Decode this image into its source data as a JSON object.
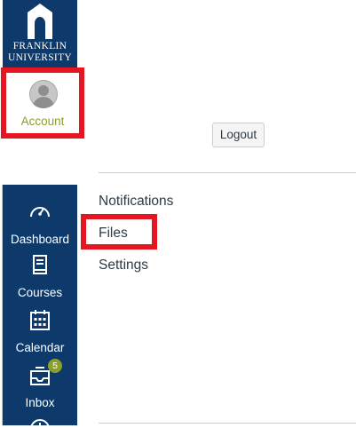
{
  "logo": {
    "line1": "FRANKLIN",
    "line2": "UNIVERSITY"
  },
  "account": {
    "label": "Account"
  },
  "profile": {
    "logout_label": "Logout",
    "links": [
      "Notifications",
      "Files",
      "Settings"
    ]
  },
  "nav": {
    "items": [
      {
        "label": "Dashboard",
        "icon": "dashboard-icon"
      },
      {
        "label": "Courses",
        "icon": "courses-icon"
      },
      {
        "label": "Calendar",
        "icon": "calendar-icon"
      },
      {
        "label": "Inbox",
        "icon": "inbox-icon",
        "badge": "5"
      }
    ]
  },
  "colors": {
    "nav_bg": "#0d3a6b",
    "highlight": "#e5161f",
    "accent": "#8b9f2a",
    "text": "#2d3b45"
  }
}
